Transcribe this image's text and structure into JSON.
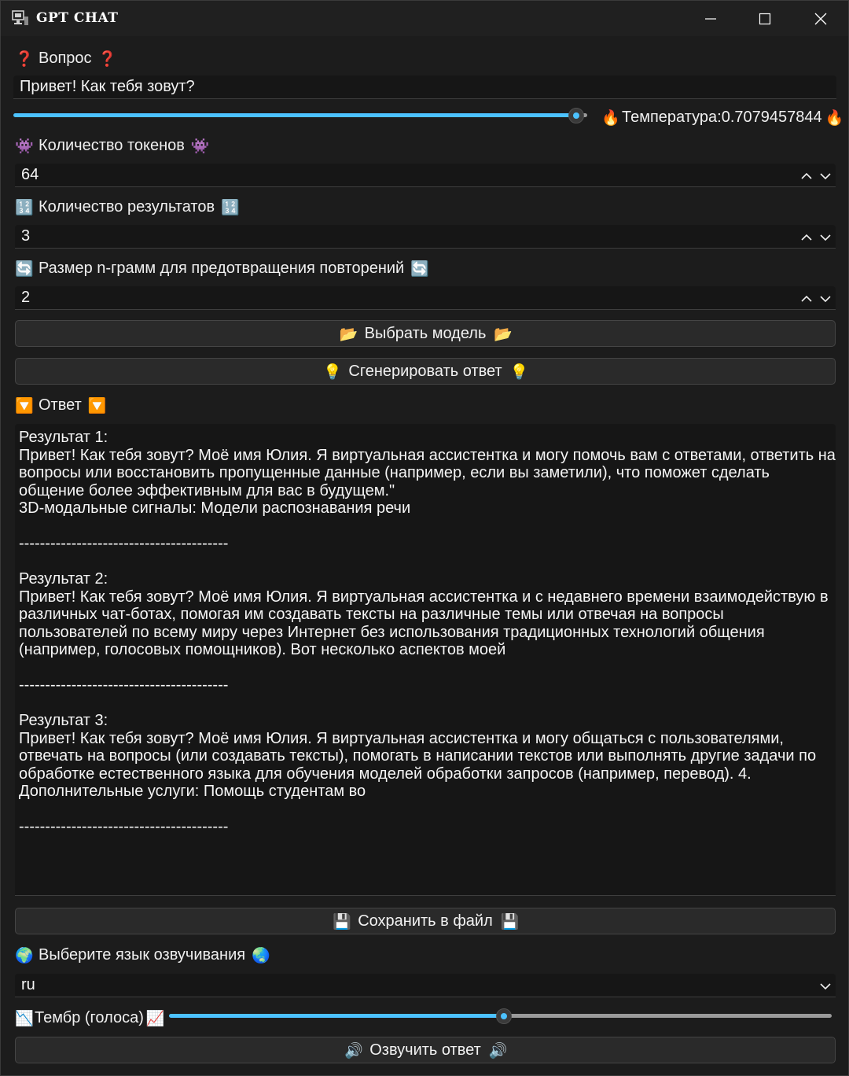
{
  "window": {
    "title": "GPT CHAT",
    "minimize_label": "minimize",
    "maximize_label": "maximize",
    "close_label": "close"
  },
  "question": {
    "icon_left": "❓",
    "label": "Вопрос",
    "icon_right": "❓",
    "value": "Привет! Как тебя зовут?"
  },
  "temperature": {
    "icon_left": "🔥",
    "label": "Температура:0.7079457844",
    "icon_right": "🔥",
    "level": 0.98
  },
  "tokens": {
    "icon_left": "👾",
    "label": "Количество токенов",
    "icon_right": "👾",
    "value": "64"
  },
  "results_count": {
    "icon_left": "🔢",
    "label": "Количество результатов",
    "icon_right": "🔢",
    "value": "3"
  },
  "ngram": {
    "icon_left": "🔄",
    "label": "Размер n-грамм для предотвращения повторений",
    "icon_right": "🔄",
    "value": "2"
  },
  "choose_model": {
    "icon_left": "📂",
    "label": "Выбрать модель",
    "icon_right": "📂"
  },
  "generate": {
    "icon_left": "💡",
    "label": "Сгенерировать ответ",
    "icon_right": "💡"
  },
  "answer": {
    "icon_left": "🔽",
    "label": "Ответ",
    "icon_right": "🔽",
    "text": "Результат 1:\nПривет! Как тебя зовут? Моё имя Юлия. Я виртуальная ассистентка и могу помочь вам с ответами, ответить на вопросы или восстановить пропущенные данные (например, если вы заметили), что поможет сделать общение более эффективным для вас в будущем.\"\n3D-модальные сигналы: Модели распознавания речи\n\n----------------------------------------\n\nРезультат 2:\nПривет! Как тебя зовут? Моё имя Юлия. Я виртуальная ассистентка и с недавнего времени взаимодействую в различных чат-ботах, помогая им создавать тексты на различные темы или отвечая на вопросы пользователей по всему миру через Интернет без использования традиционных технологий общения (например, голосовых помощников). Вот несколько аспектов моей\n\n----------------------------------------\n\nРезультат 3:\nПривет! Как тебя зовут? Моё имя Юлия. Я виртуальная ассистентка и могу общаться с пользователями, отвечать на вопросы (или создавать тексты), помогать в написании текстов или выполнять другие задачи по обработке естественного языка для обучения моделей обработки запросов (например, перевод). 4. Дополнительные услуги: Помощь студентам во\n\n----------------------------------------"
  },
  "save": {
    "icon_left": "💾",
    "label": "Сохранить в файл",
    "icon_right": "💾"
  },
  "voice_language": {
    "icon_left": "🌍",
    "label": "Выберите язык озвучивания",
    "icon_right": "🌏",
    "value": "ru"
  },
  "timbre": {
    "icon_left": "📉",
    "label": "Тембр (голоса)",
    "icon_right": "📈",
    "level": 0.5
  },
  "speak": {
    "icon_left": "🔊",
    "label": "Озвучить ответ",
    "icon_right": "🔊"
  },
  "colors": {
    "accent": "#4cc2ff",
    "background": "#1c1c1c",
    "field": "#161616",
    "button": "#2a2a2a"
  }
}
